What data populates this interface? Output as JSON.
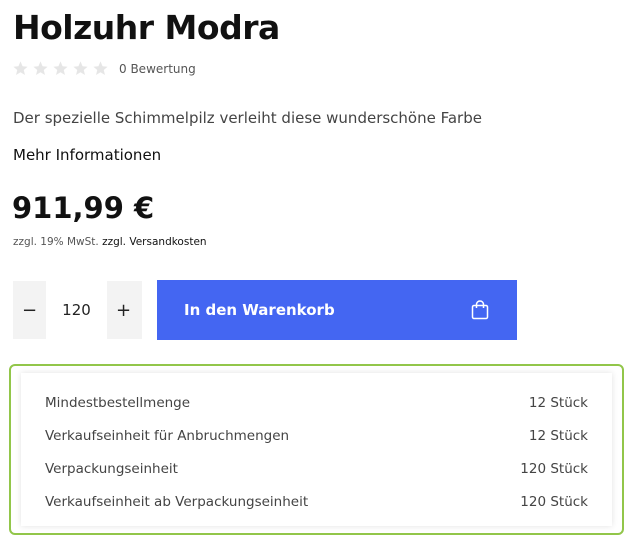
{
  "product": {
    "title": "Holzuhr Modra",
    "rating_count_text": "0 Bewertung",
    "rating_stars": 0,
    "rating_max": 5,
    "description": "Der spezielle Schimmelpilz verleiht diese wunderschöne Farbe",
    "more_info": "Mehr Informationen",
    "price": "911,99 €",
    "tax_note": "zzgl. 19% MwSt.",
    "shipping_link": "zzgl. Versandkosten"
  },
  "purchase": {
    "minus_label": "−",
    "plus_label": "+",
    "quantity": "120",
    "add_to_cart_label": "In den Warenkorb"
  },
  "info_table": [
    {
      "label": "Mindestbestellmenge",
      "value": "12 Stück"
    },
    {
      "label": "Verkaufseinheit für Anbruchmengen",
      "value": "12 Stück"
    },
    {
      "label": "Verpackungseinheit",
      "value": "120 Stück"
    },
    {
      "label": "Verkaufseinheit ab Verpackungseinheit",
      "value": "120 Stück"
    }
  ],
  "colors": {
    "accent": "#4466f2",
    "info_border": "#92c64a",
    "star_empty": "#e6e6e6"
  }
}
